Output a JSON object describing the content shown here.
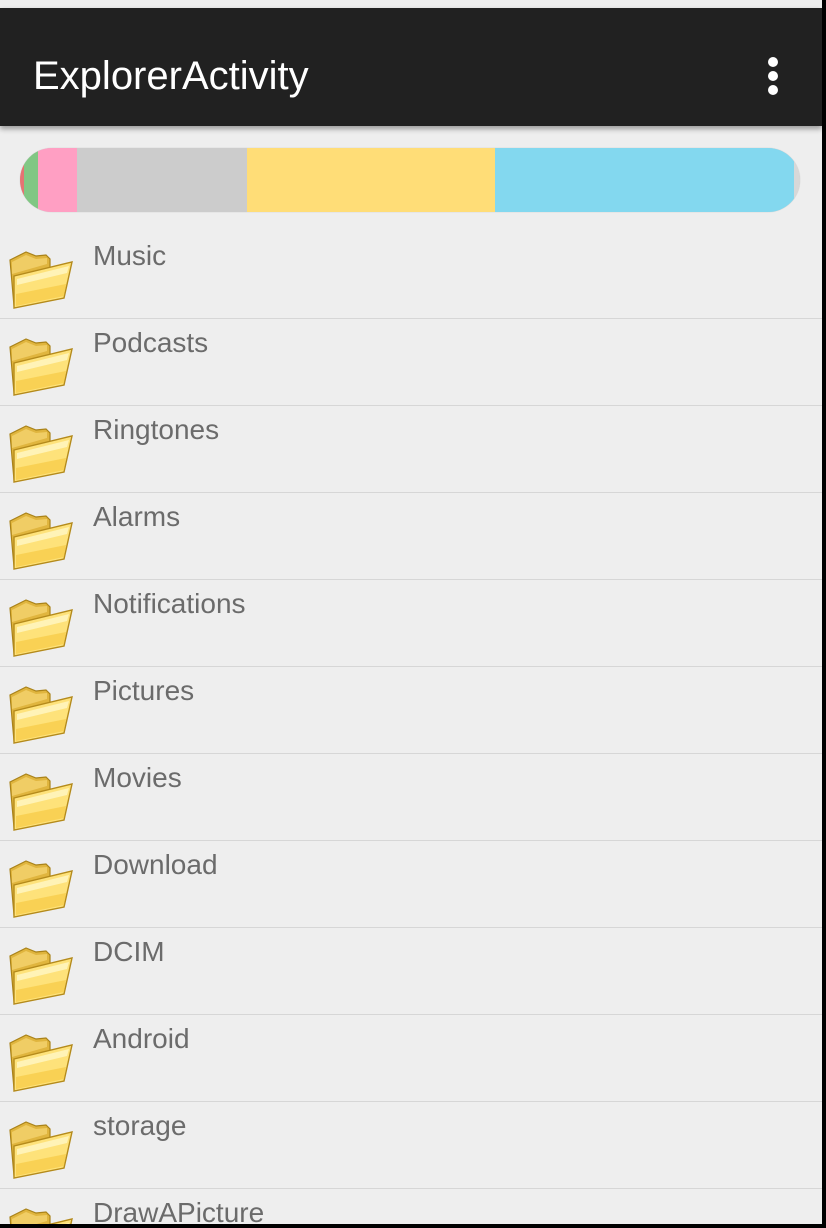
{
  "appbar": {
    "title": "ExplorerActivity",
    "background": "#212121",
    "overflow_icon": "more-vert-icon"
  },
  "storage_bar": {
    "segments": [
      {
        "color": "#e57373",
        "fraction": 0.005
      },
      {
        "color": "#81c784",
        "fraction": 0.018
      },
      {
        "color": "#ff9fc3",
        "fraction": 0.05
      },
      {
        "color": "#cccccc",
        "fraction": 0.218
      },
      {
        "color": "#ffdd77",
        "fraction": 0.318
      },
      {
        "color": "#83d8ef",
        "fraction": 0.383
      },
      {
        "color": "#d8d8d8",
        "fraction": 0.008
      }
    ]
  },
  "folders": [
    {
      "name": "Music",
      "icon": "folder-icon"
    },
    {
      "name": "Podcasts",
      "icon": "folder-icon"
    },
    {
      "name": "Ringtones",
      "icon": "folder-icon"
    },
    {
      "name": "Alarms",
      "icon": "folder-icon"
    },
    {
      "name": "Notifications",
      "icon": "folder-icon"
    },
    {
      "name": "Pictures",
      "icon": "folder-icon"
    },
    {
      "name": "Movies",
      "icon": "folder-icon"
    },
    {
      "name": "Download",
      "icon": "folder-icon"
    },
    {
      "name": "DCIM",
      "icon": "folder-icon"
    },
    {
      "name": "Android",
      "icon": "folder-icon"
    },
    {
      "name": "storage",
      "icon": "folder-icon"
    },
    {
      "name": "DrawAPicture",
      "icon": "folder-icon"
    }
  ]
}
